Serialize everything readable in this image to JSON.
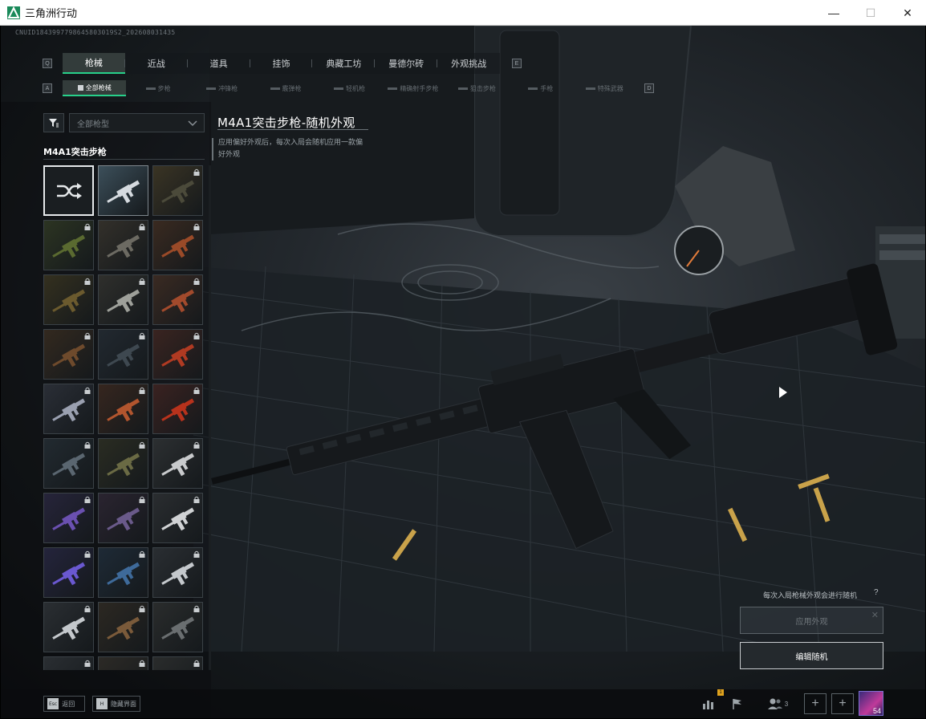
{
  "window": {
    "title": "三角洲行动",
    "controls": {
      "minimize": "—",
      "maximize": "☐",
      "close": "✕"
    }
  },
  "uid": "CNUID1843997798645803019S2_202608031435",
  "main_tabs": {
    "left_key": "Q",
    "right_key": "E",
    "items": [
      {
        "label": "枪械",
        "active": true
      },
      {
        "label": "近战",
        "active": false
      },
      {
        "label": "道具",
        "active": false
      },
      {
        "label": "挂饰",
        "active": false
      },
      {
        "label": "典藏工坊",
        "active": false
      },
      {
        "label": "曼德尔砖",
        "active": false
      },
      {
        "label": "外观挑战",
        "active": false
      }
    ]
  },
  "sub_tabs": {
    "left_key": "A",
    "right_key": "D",
    "items": [
      {
        "label": "全部枪械",
        "active": true
      },
      {
        "label": "步枪",
        "active": false
      },
      {
        "label": "冲锋枪",
        "active": false
      },
      {
        "label": "霰弹枪",
        "active": false
      },
      {
        "label": "轻机枪",
        "active": false
      },
      {
        "label": "精确射手步枪",
        "active": false
      },
      {
        "label": "狙击步枪",
        "active": false
      },
      {
        "label": "手枪",
        "active": false
      },
      {
        "label": "特殊武器",
        "active": false
      }
    ]
  },
  "filter": {
    "icon": "filter-icon",
    "select_value": "全部枪型"
  },
  "weapon_label": "M4A1突击步枪",
  "skins": {
    "random_icon": "shuffle-icon",
    "items": [
      {
        "locked": false,
        "tone": "#3c4f5a",
        "gun": "#d6dbe0",
        "selected": true
      },
      {
        "locked": true,
        "tone": "#3a3424",
        "gun": "#4b4a3a"
      },
      {
        "locked": true,
        "tone": "#2c3422",
        "gun": "#5a6a30"
      },
      {
        "locked": true,
        "tone": "#33302a",
        "gun": "#6c6a62"
      },
      {
        "locked": true,
        "tone": "#3a2a20",
        "gun": "#9a4a28"
      },
      {
        "locked": true,
        "tone": "#34301f",
        "gun": "#6b5a2e"
      },
      {
        "locked": true,
        "tone": "#2f2f2c",
        "gun": "#9ea09a"
      },
      {
        "locked": true,
        "tone": "#3a2a22",
        "gun": "#a24a2c"
      },
      {
        "locked": true,
        "tone": "#33291f",
        "gun": "#6e4a2c"
      },
      {
        "locked": true,
        "tone": "#222930",
        "gun": "#3e4850"
      },
      {
        "locked": true,
        "tone": "#3a2420",
        "gun": "#b03a22"
      },
      {
        "locked": true,
        "tone": "#2a2e36",
        "gun": "#9aa0b0"
      },
      {
        "locked": true,
        "tone": "#36261e",
        "gun": "#b2552e"
      },
      {
        "locked": true,
        "tone": "#3a2220",
        "gun": "#b8321c"
      },
      {
        "locked": true,
        "tone": "#222a30",
        "gun": "#5a6670"
      },
      {
        "locked": true,
        "tone": "#2a2c22",
        "gun": "#6a6a44"
      },
      {
        "locked": true,
        "tone": "#2c2f31",
        "gun": "#c8cacc"
      },
      {
        "locked": true,
        "tone": "#26243a",
        "gun": "#6a50b0"
      },
      {
        "locked": true,
        "tone": "#2a2430",
        "gun": "#6a5a8a"
      },
      {
        "locked": true,
        "tone": "#2a2d30",
        "gun": "#d0d2d4"
      },
      {
        "locked": true,
        "tone": "#24243c",
        "gun": "#6a58d0"
      },
      {
        "locked": true,
        "tone": "#1e2a36",
        "gun": "#3e6a9a"
      },
      {
        "locked": true,
        "tone": "#2a2e32",
        "gun": "#c4c8cc"
      },
      {
        "locked": true,
        "tone": "#2a2e32",
        "gun": "#c4c8cc"
      },
      {
        "locked": true,
        "tone": "#2c2822",
        "gun": "#7a5a3a"
      },
      {
        "locked": true,
        "tone": "#2a2c2c",
        "gun": "#6a6e70"
      },
      {
        "locked": true,
        "tone": "#2a2e32",
        "gun": "#c4c8cc"
      },
      {
        "locked": true,
        "tone": "#2c2a26",
        "gun": "#8a7a6a"
      },
      {
        "locked": true,
        "tone": "#2a2c2c",
        "gun": "#7a7e80"
      }
    ]
  },
  "detail": {
    "title": "M4A1突击步枪-随机外观",
    "description": "应用偏好外观后，每次入局会随机应用一款偏好外观"
  },
  "actions": {
    "random_note": "每次入局枪械外观会进行随机",
    "help": "?",
    "apply_label": "应用外观",
    "apply_close": "✕",
    "edit_label": "编辑随机"
  },
  "bottom_bar": {
    "back_key": "Esc",
    "back_label": "返回",
    "hide_key": "H",
    "hide_label": "隐藏界面",
    "stats_icon": "bar-chart-icon",
    "stats_badge": "1",
    "flag_icon": "flag-icon",
    "friends_icon": "friends-icon",
    "friends_count": "3",
    "add_label": "+",
    "avatar_level": "54"
  },
  "colors": {
    "accent": "#27d08a",
    "background": "#14181b",
    "text": "#d8dcdf"
  }
}
